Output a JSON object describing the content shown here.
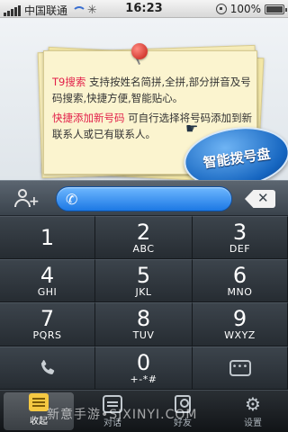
{
  "status_bar": {
    "carrier": "中国联通",
    "time": "16:23",
    "battery": "100%"
  },
  "note": {
    "line1_highlight": "T9搜索",
    "line1_text": " 支持按姓名简拼,全拼,部分拼音及号码搜索,快捷方便,智能贴心。",
    "line2_highlight": "快捷添加新号码",
    "line2_text": " 可自行选择将号码添加到新联系人或已有联系人。"
  },
  "smart_dial_button": "智能拨号盘",
  "input": {
    "value": ""
  },
  "keypad": {
    "keys": [
      {
        "digit": "1",
        "letters": ""
      },
      {
        "digit": "2",
        "letters": "ABC"
      },
      {
        "digit": "3",
        "letters": "DEF"
      },
      {
        "digit": "4",
        "letters": "GHI"
      },
      {
        "digit": "5",
        "letters": "JKL"
      },
      {
        "digit": "6",
        "letters": "MNO"
      },
      {
        "digit": "7",
        "letters": "PQRS"
      },
      {
        "digit": "8",
        "letters": "TUV"
      },
      {
        "digit": "9",
        "letters": "WXYZ"
      },
      {
        "digit": "0",
        "letters": "+-*#"
      }
    ]
  },
  "tabs": [
    {
      "label": "收起",
      "icon": "collapse-icon"
    },
    {
      "label": "对话",
      "icon": "chat-icon"
    },
    {
      "label": "好友",
      "icon": "friends-icon"
    },
    {
      "label": "设置",
      "icon": "gear-icon"
    }
  ],
  "watermark": "新意手游•SJXINYI.COM",
  "colors": {
    "accent_blue": "#1c78e4",
    "highlight_red": "#e2204a",
    "note_yellow": "#fbf4cf"
  }
}
